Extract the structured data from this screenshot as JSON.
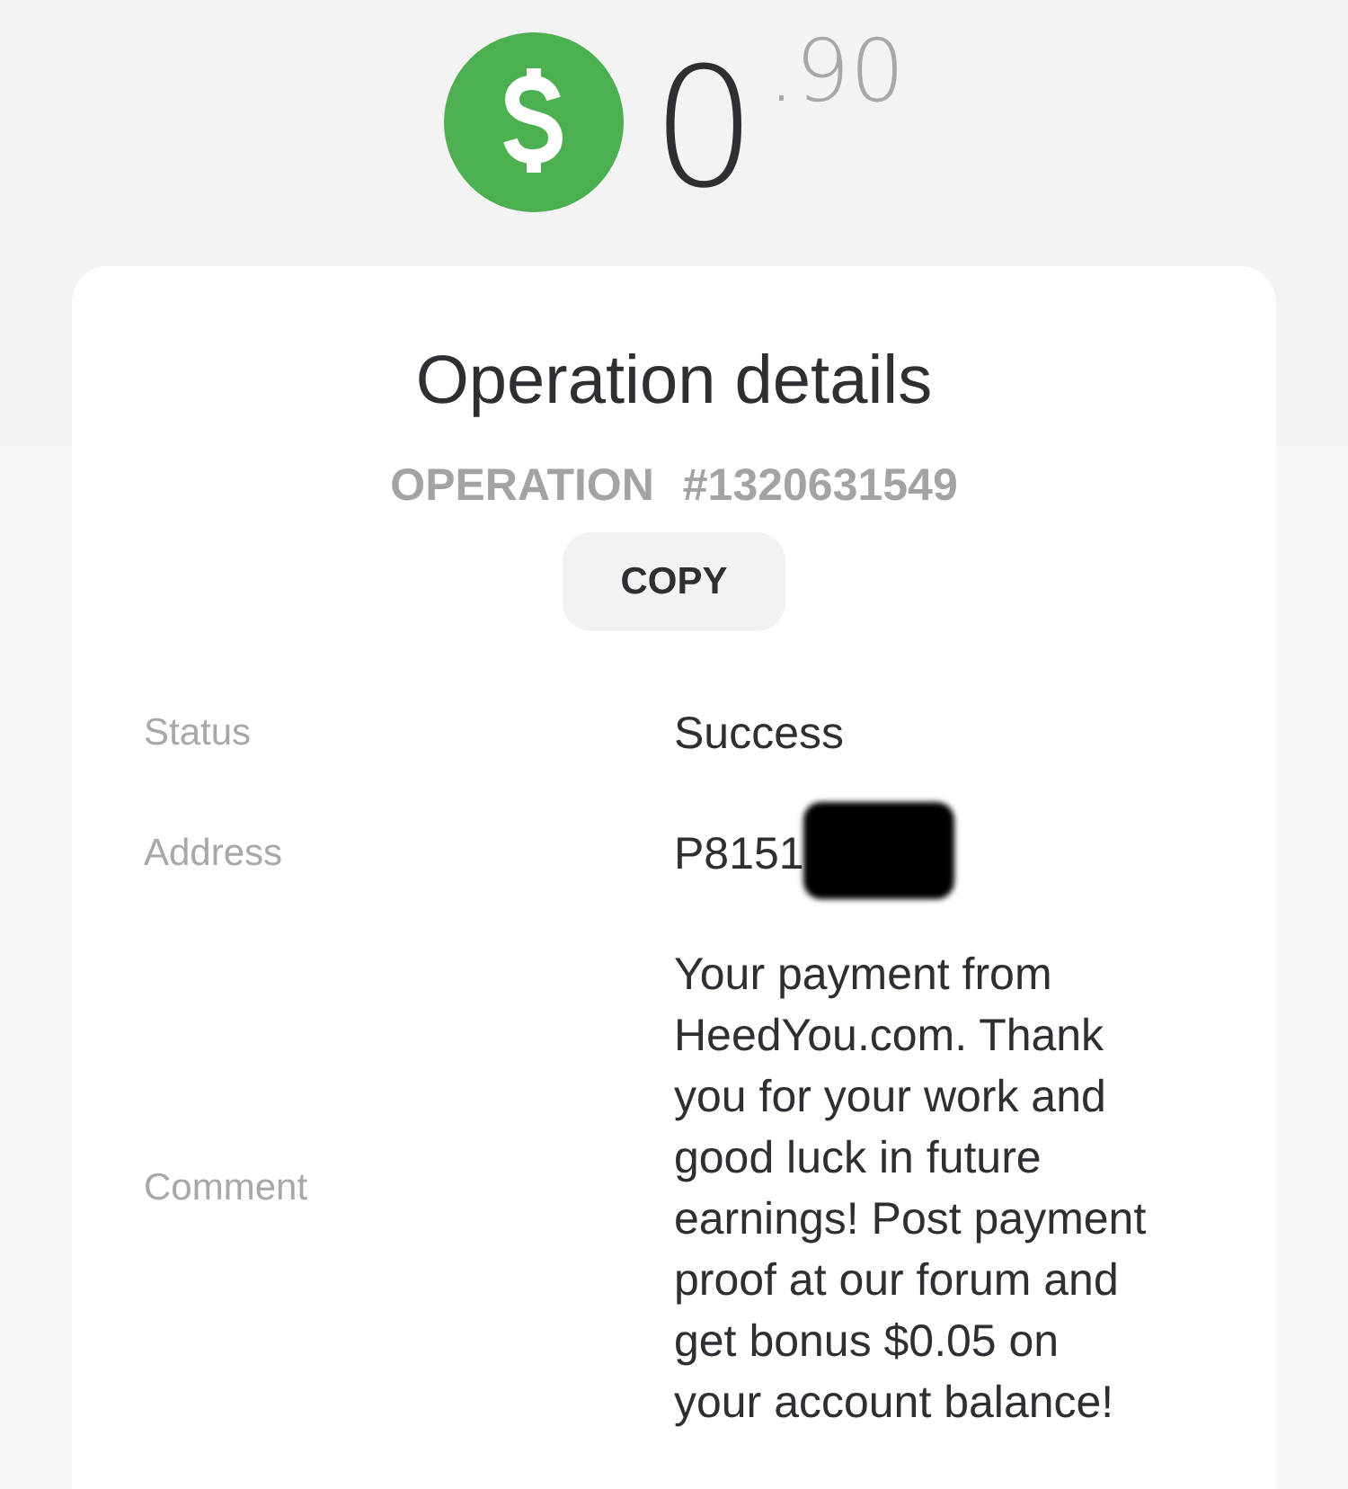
{
  "balance": {
    "whole": "0",
    "fraction": ".90"
  },
  "operation": {
    "title": "Operation details",
    "label": "OPERATION",
    "number": "#1320631549",
    "copy_button": "COPY"
  },
  "details": [
    {
      "label": "Status",
      "value": "Success",
      "redacted": false
    },
    {
      "label": "Address",
      "value": "P8151",
      "redacted": true
    },
    {
      "label": "Comment",
      "value": "Your payment from HeedYou.com. Thank you for your work and good luck in future earnings! Post payment proof at our forum and get bonus $0.05 on your account balance!",
      "redacted": false
    }
  ]
}
